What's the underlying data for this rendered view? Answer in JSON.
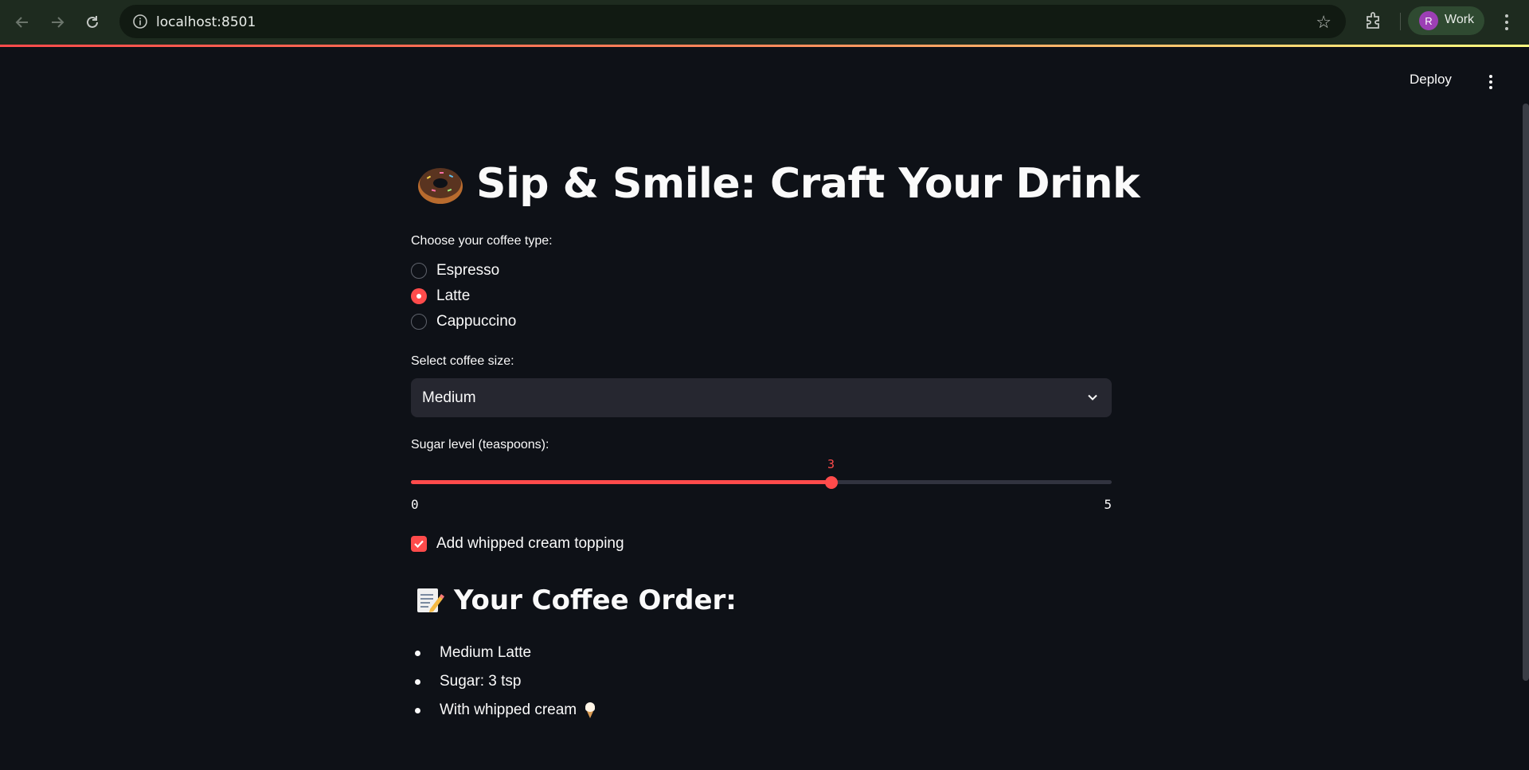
{
  "browser": {
    "url": "localhost:8501",
    "profile_initial": "R",
    "profile_label": "Work"
  },
  "header": {
    "deploy_label": "Deploy"
  },
  "app": {
    "title": "Sip & Smile: Craft Your Drink",
    "title_icon": "donut-icon",
    "coffee_type": {
      "label": "Choose your coffee type:",
      "options": [
        "Espresso",
        "Latte",
        "Cappuccino"
      ],
      "selected": "Latte"
    },
    "size": {
      "label": "Select coffee size:",
      "value": "Medium"
    },
    "sugar": {
      "label": "Sugar level (teaspoons):",
      "value": "3",
      "min": "0",
      "max": "5",
      "fraction": 0.6
    },
    "whipped_cream": {
      "label": "Add whipped cream topping",
      "checked": true
    },
    "order": {
      "heading": "Your Coffee Order:",
      "heading_icon": "memo-icon",
      "items": [
        "Medium Latte",
        "Sugar: 3 tsp",
        "With whipped cream"
      ],
      "cream_icon": "ice-cream-icon"
    }
  },
  "colors": {
    "accent": "#ff4b4b",
    "background": "#0e1117",
    "input_bg": "#262730"
  }
}
